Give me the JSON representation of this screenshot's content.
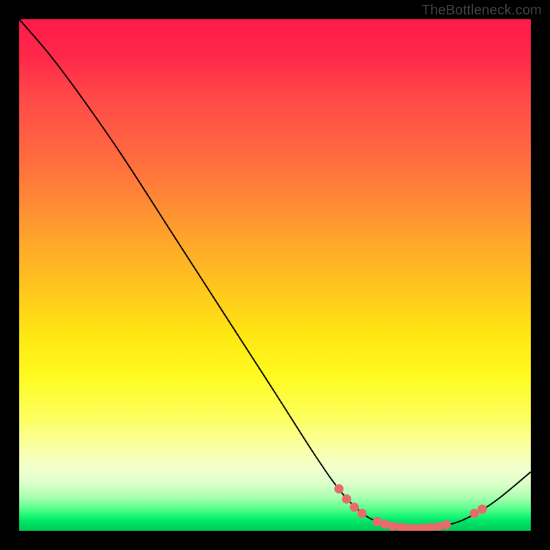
{
  "watermark": "TheBottleneck.com",
  "chart_data": {
    "type": "line",
    "title": "",
    "xlabel": "",
    "ylabel": "",
    "xlim": [
      0,
      100
    ],
    "ylim": [
      0,
      100
    ],
    "curve": [
      {
        "x": 0,
        "y": 100
      },
      {
        "x": 6,
        "y": 93
      },
      {
        "x": 12,
        "y": 85
      },
      {
        "x": 20,
        "y": 73.5
      },
      {
        "x": 30,
        "y": 58
      },
      {
        "x": 40,
        "y": 42.5
      },
      {
        "x": 50,
        "y": 27
      },
      {
        "x": 58,
        "y": 14.5
      },
      {
        "x": 63,
        "y": 7.5
      },
      {
        "x": 67,
        "y": 3.5
      },
      {
        "x": 70,
        "y": 1.8
      },
      {
        "x": 74,
        "y": 0.8
      },
      {
        "x": 78,
        "y": 0.5
      },
      {
        "x": 82,
        "y": 0.8
      },
      {
        "x": 86,
        "y": 1.8
      },
      {
        "x": 90,
        "y": 3.8
      },
      {
        "x": 94,
        "y": 6.5
      },
      {
        "x": 100,
        "y": 11.5
      }
    ],
    "marker_points": [
      {
        "x": 62.5,
        "y": 8.2
      },
      {
        "x": 64.0,
        "y": 6.2
      },
      {
        "x": 65.5,
        "y": 4.6
      },
      {
        "x": 67.0,
        "y": 3.4
      },
      {
        "x": 70.0,
        "y": 1.8
      },
      {
        "x": 71.5,
        "y": 1.3
      },
      {
        "x": 73.0,
        "y": 0.9
      },
      {
        "x": 74.5,
        "y": 0.7
      },
      {
        "x": 76.0,
        "y": 0.55
      },
      {
        "x": 77.5,
        "y": 0.5
      },
      {
        "x": 79.0,
        "y": 0.55
      },
      {
        "x": 80.5,
        "y": 0.65
      },
      {
        "x": 82.0,
        "y": 0.85
      },
      {
        "x": 83.5,
        "y": 1.15
      },
      {
        "x": 89.0,
        "y": 3.4
      },
      {
        "x": 90.5,
        "y": 4.2
      }
    ],
    "marker_radius_frac": 0.009,
    "gradient_note": "vertical red-to-green heatmap background"
  }
}
